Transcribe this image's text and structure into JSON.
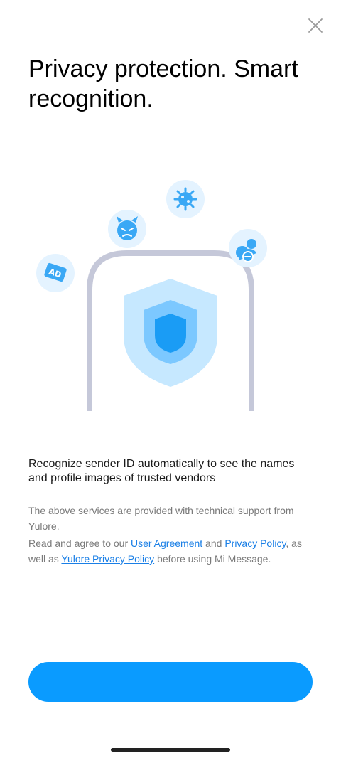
{
  "title": "Privacy protection. Smart recognition.",
  "feature_description": "Recognize sender ID automatically to see the names and profile images of trusted vendors",
  "provider_note": "The above services are provided with technical support from Yulore.",
  "agreement": {
    "prefix": "Read and agree to our ",
    "user_agreement_link": "User Agreement",
    "and_text": " and ",
    "privacy_policy_link": "Privacy Policy",
    "middle_text": ", as well as ",
    "yulore_policy_link": "Yulore Privacy Policy",
    "suffix": " before using Mi Message."
  },
  "illustration": {
    "ad_badge_text": "AD"
  },
  "primary_button_label": "",
  "icons": {
    "close": "close-icon",
    "ad": "ad-icon",
    "spam_bot": "spam-bot-icon",
    "virus": "virus-icon",
    "block": "block-icon",
    "shield": "shield-icon"
  },
  "colors": {
    "accent": "#0a9bff",
    "link": "#1a7fe6",
    "icon_bubble": "#e4f3ff",
    "icon_blue": "#3aa8f5",
    "shield_outer": "#c6e8ff",
    "shield_mid": "#7cc8ff",
    "shield_inner": "#1a9cf5",
    "phone_frame": "#c5c8d9"
  }
}
